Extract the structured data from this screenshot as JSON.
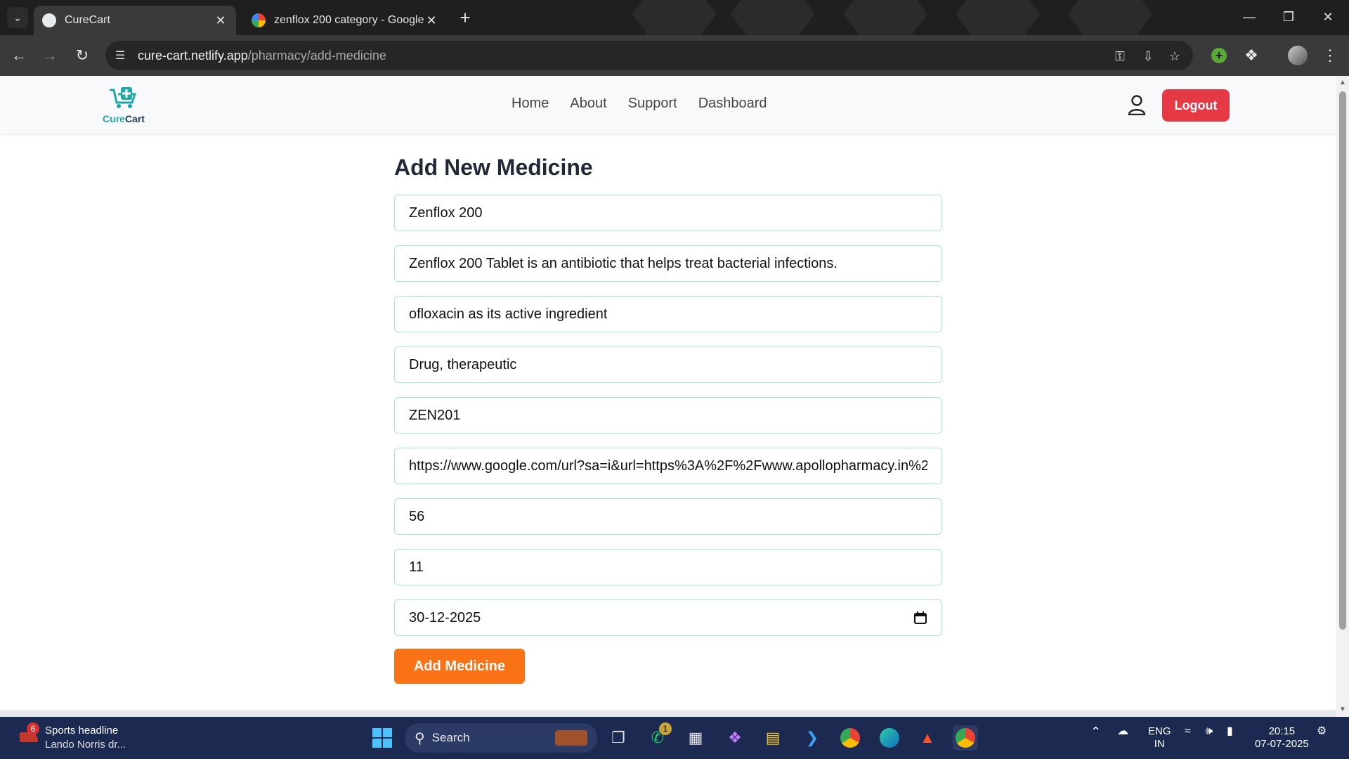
{
  "browser": {
    "tabs": [
      {
        "title": "CureCart",
        "active": true
      },
      {
        "title": "zenflox 200 category - Google S",
        "active": false
      }
    ],
    "url_host": "cure-cart.netlify.app",
    "url_path": "/pharmacy/add-medicine"
  },
  "navbar": {
    "logo_prefix": "Cure",
    "logo_suffix": "Cart",
    "links": [
      "Home",
      "About",
      "Support",
      "Dashboard"
    ],
    "logout_label": "Logout"
  },
  "form": {
    "heading": "Add New Medicine",
    "fields": [
      {
        "name": "name",
        "value": "Zenflox 200"
      },
      {
        "name": "description",
        "value": "Zenflox 200 Tablet is an antibiotic that helps treat bacterial infections."
      },
      {
        "name": "composition",
        "value": "ofloxacin as its active ingredient"
      },
      {
        "name": "category",
        "value": "Drug, therapeutic"
      },
      {
        "name": "code",
        "value": "ZEN201"
      },
      {
        "name": "image-url",
        "value": "https://www.google.com/url?sa=i&url=https%3A%2F%2Fwww.apollopharmacy.in%2"
      },
      {
        "name": "price",
        "value": "56"
      },
      {
        "name": "stock",
        "value": "11"
      },
      {
        "name": "expiry-date",
        "value": "30-12-2025"
      }
    ],
    "submit_label": "Add Medicine"
  },
  "taskbar": {
    "news_badge": "6",
    "news_title": "Sports headline",
    "news_sub": "Lando Norris dr...",
    "search_label": "Search",
    "whatsapp_badge": "1",
    "lang_top": "ENG",
    "lang_bottom": "IN",
    "time": "20:15",
    "date": "07-07-2025"
  },
  "colors": {
    "logout": "#e63946",
    "submit": "#f97316",
    "field_border": "#a7e6df",
    "brand_teal": "#1fa8a6"
  }
}
